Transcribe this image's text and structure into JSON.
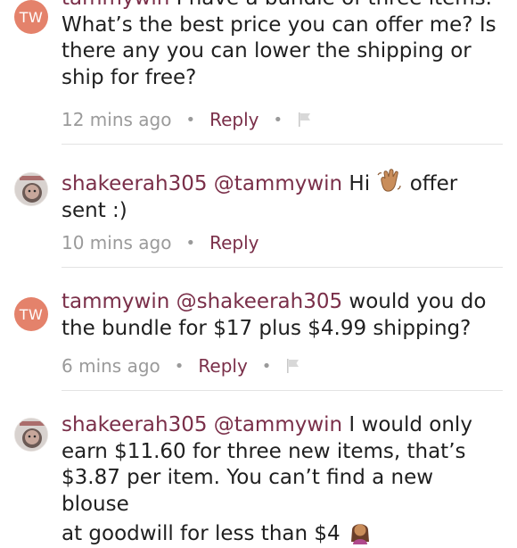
{
  "comments": [
    {
      "user": "tammywin",
      "initials": "TW",
      "mention": "",
      "text_1": "I have a bundle of three items.",
      "text_2": "What’s the best price you can offer me? Is",
      "text_3": "there any you can lower the shipping or",
      "text_4": "ship for free?",
      "time": "12 mins ago",
      "reply_label": "Reply"
    },
    {
      "user": "shakeerah305",
      "mention": "@tammywin",
      "text_1": "Hi",
      "text_2": "offer",
      "text_3": "sent :)",
      "time": "10 mins ago",
      "reply_label": "Reply"
    },
    {
      "user": "tammywin",
      "initials": "TW",
      "mention": "@shakeerah305",
      "text_1": "would you do",
      "text_2": "the bundle for $17 plus $4.99 shipping?",
      "time": "6 mins ago",
      "reply_label": "Reply"
    },
    {
      "user": "shakeerah305",
      "mention": "@tammywin",
      "text_1": "I would only",
      "text_2": "earn $11.60 for three new items, that’s",
      "text_3": "$3.87 per item. You can’t find a new blouse",
      "text_4": "at goodwill for less than $4"
    }
  ],
  "colors": {
    "username": "#7a2f49",
    "reply_link": "#7a2f49",
    "meta_gray": "#9a9a9a",
    "avatar_initials_bg": "#e4826b"
  },
  "icons": [
    "flag-icon",
    "waving-hand-emoji",
    "person-tipping-hand-emoji"
  ]
}
